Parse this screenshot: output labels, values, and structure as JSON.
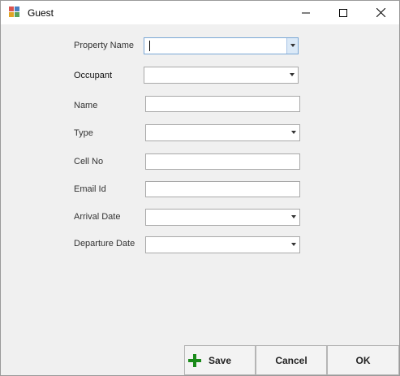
{
  "window": {
    "title": "Guest"
  },
  "form": {
    "property_name_label": "Property Name",
    "occupant_label": "Occupant",
    "name_label": "Name",
    "type_label": "Type",
    "cell_no_label": "Cell No",
    "email_label": "Email Id",
    "arrival_date_label": "Arrival Date",
    "departure_date_label": "Departure Date",
    "property_name_value": "",
    "occupant_value": "",
    "name_value": "",
    "type_value": "",
    "cell_no_value": "",
    "email_value": "",
    "arrival_date_value": "",
    "departure_date_value": ""
  },
  "buttons": {
    "save_label": "Save",
    "cancel_label": "Cancel",
    "ok_label": "OK"
  },
  "icons": {
    "app": "form-app-icon",
    "minimize": "minimize-icon",
    "maximize": "maximize-icon",
    "close": "close-icon",
    "save": "plus-icon"
  },
  "colors": {
    "window_bg": "#f0f0f0",
    "save_icon": "#1a8a1a",
    "focus_border": "#7aa7d6"
  }
}
